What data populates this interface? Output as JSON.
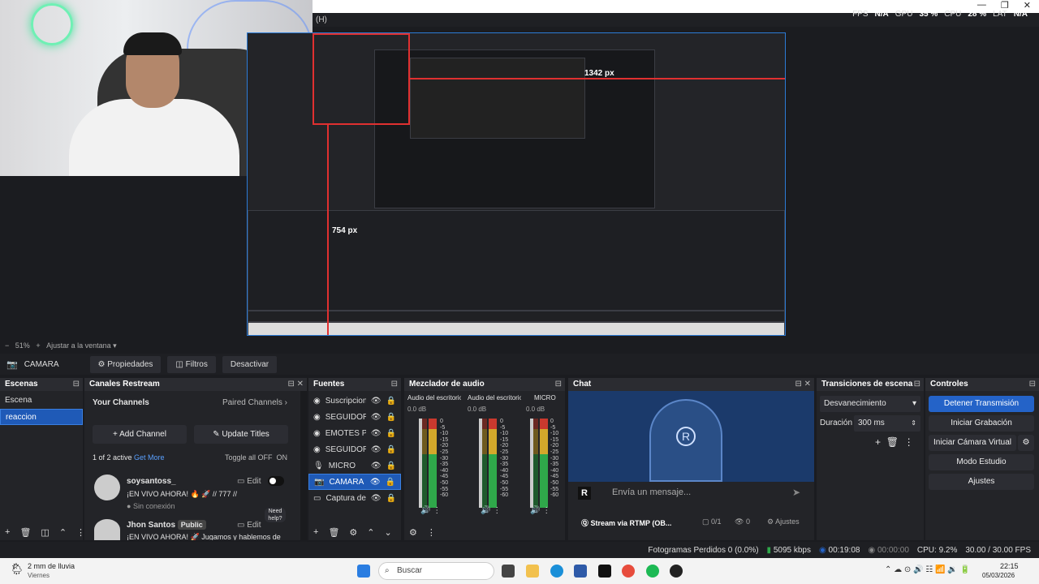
{
  "menubar": {
    "help": "(H)"
  },
  "stats": {
    "fps_label": "FPS",
    "fps": "N/A",
    "gpu_label": "GPU",
    "gpu": "35 %",
    "cpu_label": "CPU",
    "cpu": "28 %",
    "lat_label": "LAT",
    "lat": "N/A"
  },
  "preview": {
    "measure_h": "1342 px",
    "measure_v": "754 px"
  },
  "zoom": {
    "level": "51%",
    "fit": "Ajustar a la ventana"
  },
  "context": {
    "source": "CAMARA",
    "props": "Propiedades",
    "filters": "Filtros",
    "deactivate": "Desactivar"
  },
  "scenes": {
    "title": "Escenas",
    "items": [
      "Escena",
      "reaccion"
    ]
  },
  "restream": {
    "title": "Canales Restream",
    "your_channels": "Your Channels",
    "paired": "Paired Channels",
    "add": "Add Channel",
    "update": "Update Titles",
    "active": "1 of 2 active",
    "get_more": "Get More",
    "toggle": "Toggle all OFF",
    "on": "ON",
    "channels": [
      {
        "name": "soysantoss_",
        "title": "¡EN VIVO AHORA! 🔥 🚀 // 777 //",
        "status": "Sin conexión",
        "edit": "Edit"
      },
      {
        "name": "Jhon Santos",
        "badge": "Public",
        "title": "¡EN VIVO AHORA! 🚀 Jugamos y hablemos de",
        "edit": "Edit"
      }
    ],
    "help": "Need help?"
  },
  "sources": {
    "title": "Fuentes",
    "items": [
      "Suscripcion",
      "SEGUIDORE",
      "EMOTES PA",
      "SEGUIDOR1",
      "MICRO",
      "CAMARA",
      "Captura de"
    ]
  },
  "mixer": {
    "title": "Mezclador de audio",
    "channels": [
      {
        "name": "Audio del escritorio",
        "db": "0.0 dB"
      },
      {
        "name": "Audio del escritorio",
        "db": "0.0 dB"
      },
      {
        "name": "MICRO",
        "db": "0.0 dB"
      }
    ],
    "ticks": [
      "0",
      "-5",
      "-10",
      "-15",
      "-20",
      "-25",
      "-30",
      "-35",
      "-40",
      "-45",
      "-50",
      "-55",
      "-60"
    ]
  },
  "chat": {
    "title": "Chat",
    "placeholder": "Envía un mensaje...",
    "stream": "Stream via RTMP (OB...",
    "viewers": "0/1",
    "views": "0",
    "settings": "Ajustes"
  },
  "transitions": {
    "title": "Transiciones de escena",
    "type": "Desvanecimiento",
    "duration_label": "Duración",
    "duration": "300 ms"
  },
  "controls": {
    "title": "Controles",
    "stop": "Detener Transmisión",
    "record": "Iniciar Grabación",
    "vcam": "Iniciar Cámara Virtual",
    "studio": "Modo Estudio",
    "settings": "Ajustes"
  },
  "status": {
    "dropped": "Fotogramas Perdidos 0 (0.0%)",
    "kbps": "5095 kbps",
    "live": "00:19:08",
    "rec": "00:00:00",
    "cpu": "CPU: 9.2%",
    "fps": "30.00 / 30.00 FPS"
  },
  "taskbar": {
    "weather": "2 mm de lluvia",
    "day": "Viernes",
    "search": "Buscar",
    "time": "22:15",
    "date": "05/03/2026"
  },
  "colors": {
    "accent": "#2463c8",
    "selection": "#e03030",
    "meter_green": "#2fa84a"
  }
}
